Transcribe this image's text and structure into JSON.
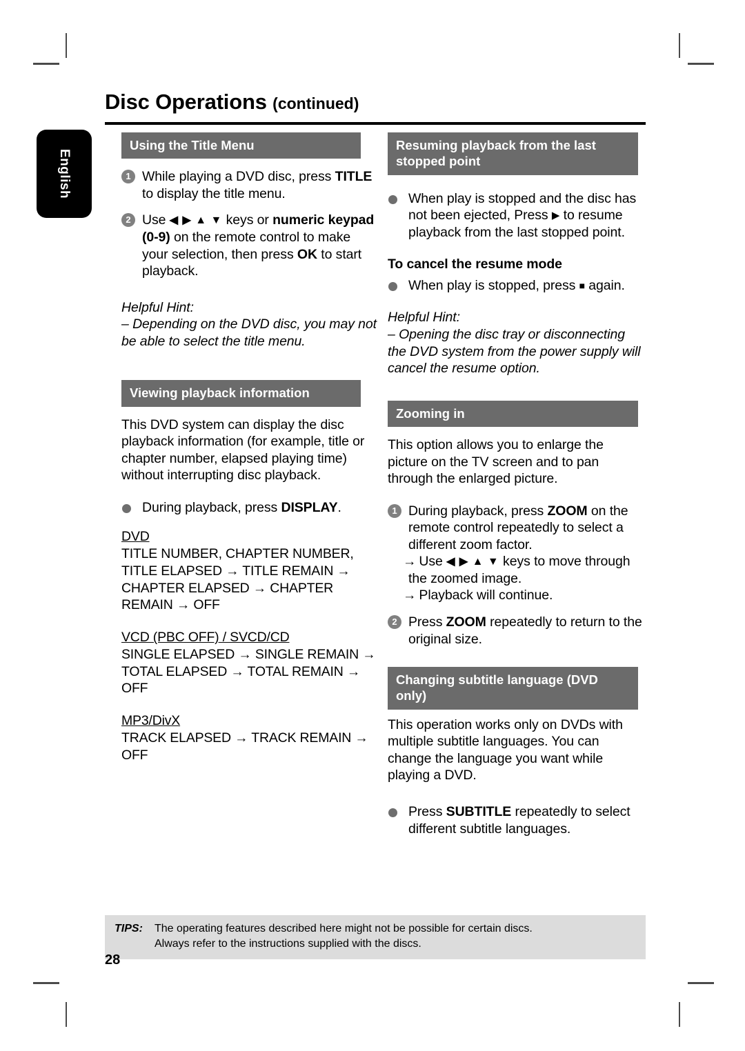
{
  "page": {
    "title": "Disc Operations",
    "title_suffix": "(continued)",
    "language_tab": "English",
    "page_number": "28"
  },
  "left_column": {
    "section_title_menu": {
      "heading": "Using the Title Menu",
      "steps": [
        {
          "num": "1",
          "text_before": "While playing a DVD disc, press ",
          "bold": "TITLE",
          "text_after": " to display the title menu."
        },
        {
          "num": "2",
          "part1": "Use ",
          "keys": "◀ ▶ ▲ ▼",
          "part2": " keys or ",
          "bold1": "numeric keypad (0-9)",
          "part3": " on the remote control to make your selection, then press ",
          "bold2": "OK",
          "part4": " to start playback."
        }
      ],
      "hint_label": "Helpful Hint:",
      "hint_text": "– Depending on the DVD disc, you may not be able to select the title menu."
    },
    "section_playback_info": {
      "heading": "Viewing playback information",
      "intro": "This DVD system can display the disc playback information (for example, title or chapter number, elapsed playing time) without interrupting disc playback.",
      "bullet_before": "During playback, press ",
      "bullet_bold": "DISPLAY",
      "bullet_after": ".",
      "groups": [
        {
          "label": "DVD",
          "items": "TITLE NUMBER, CHAPTER NUMBER, TITLE ELAPSED → TITLE REMAIN → CHAPTER ELAPSED → CHAPTER REMAIN → OFF"
        },
        {
          "label": "VCD (PBC OFF) / SVCD/CD",
          "items": "SINGLE ELAPSED → SINGLE REMAIN → TOTAL ELAPSED → TOTAL REMAIN → OFF"
        },
        {
          "label": "MP3/DivX",
          "items": "TRACK ELAPSED → TRACK REMAIN → OFF"
        }
      ]
    }
  },
  "right_column": {
    "section_resume": {
      "heading": "Resuming playback from the last stopped point",
      "bullet_part1": "When play is stopped and the disc has not been ejected, Press ",
      "bullet_symbol": "▶",
      "bullet_part2": " to resume playback from the last stopped point.",
      "cancel_heading": "To cancel the resume mode",
      "cancel_part1": "When play is stopped, press ",
      "cancel_symbol": "■",
      "cancel_part2": " again.",
      "hint_label": "Helpful Hint:",
      "hint_text": "– Opening the disc tray or disconnecting the DVD system from the power supply will cancel the resume option."
    },
    "section_zoom": {
      "heading": "Zooming in",
      "intro": "This option allows you to enlarge the picture on the TV screen and to pan through the enlarged picture.",
      "step1": {
        "num": "1",
        "part1": "During playback, press ",
        "bold": "ZOOM",
        "part2": " on the remote control repeatedly to select a different zoom factor."
      },
      "arrow1": {
        "marker": "→",
        "part1": "Use ",
        "keys": "◀ ▶ ▲ ▼",
        "part2": " keys to move through the zoomed image."
      },
      "arrow2": {
        "marker": "→",
        "text": "Playback will continue."
      },
      "step2": {
        "num": "2",
        "part1": "Press ",
        "bold": "ZOOM",
        "part2": " repeatedly to return to the original size."
      }
    },
    "section_subtitle": {
      "heading": "Changing subtitle language (DVD only)",
      "intro": "This operation works only on DVDs with multiple subtitle languages. You can change the language you want while playing a DVD.",
      "bullet_part1": "Press ",
      "bullet_bold": "SUBTITLE",
      "bullet_part2": " repeatedly to select different subtitle languages."
    }
  },
  "footer": {
    "tips_label": "TIPS:",
    "tips_line1": "The operating features described here might not be possible for certain discs.",
    "tips_line2": "Always refer to the instructions supplied with the discs."
  }
}
